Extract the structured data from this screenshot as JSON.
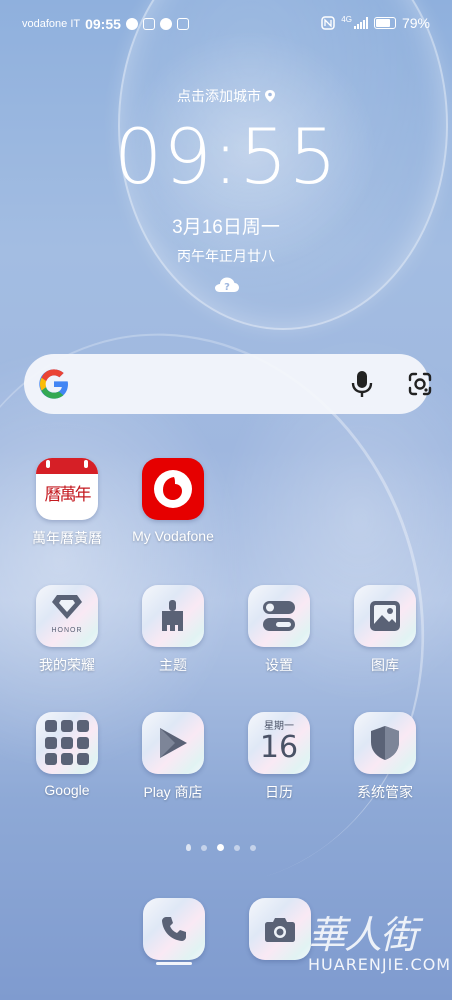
{
  "status_bar": {
    "carrier": "vodafone IT",
    "time": "09:55",
    "network": "4G",
    "battery": "79%",
    "battery_level": 0.79,
    "left_icons": [
      "facebook-icon",
      "instagram-icon",
      "facebook-icon",
      "instagram-icon"
    ],
    "right_icons": [
      "nfc-icon",
      "signal-icon",
      "battery-icon"
    ]
  },
  "clock_widget": {
    "city": "点击添加城市",
    "time": "09:55",
    "date": "3月16日周一",
    "lunar": "丙午年正月廿八",
    "weather_icon": "cloud-question-icon"
  },
  "search_bar": {
    "logo": "google-g-icon",
    "mic_icon": "mic-icon",
    "lens_icon": "google-lens-icon"
  },
  "apps": [
    {
      "label": "萬年曆黃曆",
      "icon": "calendar-almanac-icon"
    },
    {
      "label": "My Vodafone",
      "icon": "vodafone-icon"
    },
    {
      "label": "我的荣耀",
      "icon": "honor-icon",
      "icon_text": "HONOR"
    },
    {
      "label": "主题",
      "icon": "theme-brush-icon"
    },
    {
      "label": "设置",
      "icon": "settings-toggle-icon"
    },
    {
      "label": "图库",
      "icon": "gallery-icon"
    },
    {
      "label": "Google",
      "icon": "google-folder-icon"
    },
    {
      "label": "Play 商店",
      "icon": "play-store-icon"
    },
    {
      "label": "日历",
      "icon": "calendar-icon",
      "icon_weekday": "星期一",
      "icon_day": "16"
    },
    {
      "label": "系统管家",
      "icon": "shield-icon"
    }
  ],
  "almanac_icon_text": "曆萬年",
  "page_indicator": {
    "count": 5,
    "active_index": 2
  },
  "dock": [
    {
      "icon": "phone-icon"
    },
    {
      "icon": "camera-icon"
    }
  ],
  "watermark": {
    "chinese": "華人街",
    "latin": "HUARENJIE.COM"
  },
  "colors": {
    "vodafone_red": "#e60000",
    "wallpaper": "#9fb7df",
    "search_bg": "#f4f6fb"
  }
}
